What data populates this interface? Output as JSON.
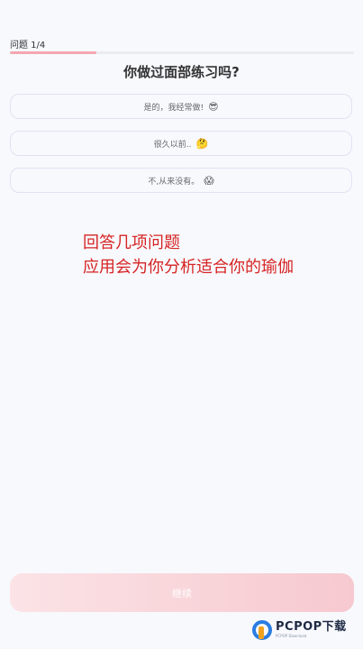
{
  "progress": {
    "label": "问题 1/4",
    "fraction": 0.25,
    "fill_color": "#f4a6b0"
  },
  "question": {
    "title": "你做过面部练习吗?"
  },
  "options": [
    {
      "label": "是的，我经常做!",
      "emoji": "😎"
    },
    {
      "label": "很久以前..",
      "emoji": "🤔"
    },
    {
      "label": "不,从来没有。",
      "emoji": "😱"
    }
  ],
  "overlay": {
    "line1": "回答几项问题",
    "line2": "应用会为你分析适合你的瑜伽",
    "color": "#d62424"
  },
  "footer": {
    "continue_label": "继续"
  },
  "watermark": {
    "text": "PCPOP下载",
    "sub": "PCPOP Download"
  }
}
